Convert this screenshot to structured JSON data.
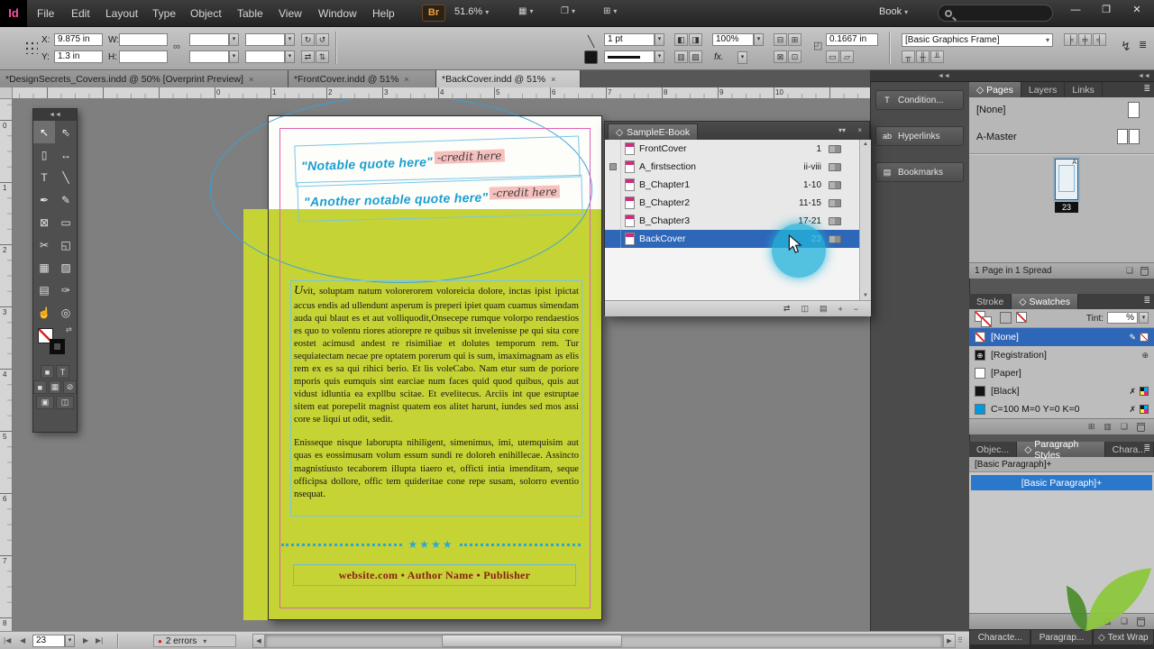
{
  "glyphs": {
    "dropdown": "▾",
    "collapse": "◄◄",
    "panel_menu": "≣",
    "tab_close": "×",
    "minimize_pair": "▾▾",
    "close": "×",
    "diamond": "◇",
    "chain": "∞",
    "rotate_cw": "↻",
    "rotate_ccw": "↺",
    "flip_h": "⇄",
    "flip_v": "⇅",
    "stroke_diag": "╲",
    "lightning": "↯",
    "prev": "◀",
    "next": "▶",
    "first": "|◀",
    "last": "▶|",
    "up": "▲",
    "down": "▼",
    "error_dot": "●",
    "reg_mark": "⊕",
    "pencil": "✎",
    "x_mark": "✗",
    "sync": "⇄",
    "save": "◫",
    "print": "▤",
    "plus": "+",
    "minus": "−",
    "new_page": "❏",
    "grip": "⠿",
    "win_min": "—",
    "win_restore": "❐",
    "win_close": "✕",
    "percent": "%",
    "fx": "fx.",
    "view_options": "▦",
    "screen_mode": "❐",
    "arrange_docs": "⊞",
    "corner": "◰",
    "m1": "◧",
    "m2": "◨",
    "m3": "▥",
    "m4": "▧",
    "m5": "▭",
    "m6": "▱",
    "b1": "⊟",
    "b2": "⊞",
    "b3": "⊠",
    "b4": "⊡",
    "a1": "╞",
    "a2": "╪",
    "a3": "╡",
    "a4": "╥",
    "a5": "╫",
    "a6": "╨"
  },
  "menubar": {
    "logo": "Id",
    "items": [
      "File",
      "Edit",
      "Layout",
      "Type",
      "Object",
      "Table",
      "View",
      "Window",
      "Help"
    ],
    "bridge": "Br",
    "zoom": "51.6%",
    "workspace": "Book"
  },
  "control_panel": {
    "x_label": "X:",
    "x_value": "9.875 in",
    "y_label": "Y:",
    "y_value": "1.3 in",
    "w_label": "W:",
    "w_value": "",
    "h_label": "H:",
    "h_value": "",
    "scale_x": "",
    "scale_y": "",
    "rotation": "",
    "shear": "",
    "stroke_weight": "1 pt",
    "opacity": "100%",
    "corner_radius": "0.1667 in",
    "style_name": "[Basic Graphics Frame]"
  },
  "doc_tabs": [
    {
      "label": "*DesignSecrets_Covers.indd @ 50% [Overprint Preview]"
    },
    {
      "label": "*FrontCover.indd @ 51%"
    },
    {
      "label": "*BackCover.indd @ 51%"
    }
  ],
  "rulers": {
    "h": [
      "0",
      "1",
      "2",
      "3",
      "4",
      "5",
      "6",
      "7",
      "8",
      "9",
      "10"
    ],
    "v": [
      "0",
      "1",
      "2",
      "3",
      "4",
      "5",
      "6",
      "7",
      "8"
    ]
  },
  "tools": [
    {
      "name": "selection-tool",
      "glyph": "↖"
    },
    {
      "name": "direct-selection-tool",
      "glyph": "⇖"
    },
    {
      "name": "page-tool",
      "glyph": "▯"
    },
    {
      "name": "gap-tool",
      "glyph": "↔"
    },
    {
      "name": "type-tool",
      "glyph": "T"
    },
    {
      "name": "line-tool",
      "glyph": "╲"
    },
    {
      "name": "pen-tool",
      "glyph": "✒"
    },
    {
      "name": "pencil-tool",
      "glyph": "✎"
    },
    {
      "name": "rectangle-frame-tool",
      "glyph": "⊠"
    },
    {
      "name": "rectangle-tool",
      "glyph": "▭"
    },
    {
      "name": "scissors-tool",
      "glyph": "✂"
    },
    {
      "name": "free-transform-tool",
      "glyph": "◱"
    },
    {
      "name": "gradient-swatch-tool",
      "glyph": "▦"
    },
    {
      "name": "gradient-feather-tool",
      "glyph": "▨"
    },
    {
      "name": "note-tool",
      "glyph": "▤"
    },
    {
      "name": "eyedropper-tool",
      "glyph": "✑"
    },
    {
      "name": "hand-tool",
      "glyph": "☝"
    },
    {
      "name": "zoom-tool",
      "glyph": "◎"
    }
  ],
  "tool_extras": {
    "container": "■",
    "text": "T",
    "fill": "■",
    "gradient": "▦",
    "none": "⊘",
    "normal": "▣",
    "preview": "◫"
  },
  "document": {
    "quote1": "\"Notable quote here\"",
    "credit1": "-credit here",
    "quote2": "\"Another notable quote here\"",
    "credit2": "-credit here",
    "body_p1": "Uvit, soluptam natum volorerorem voloreicia dolore, inctas ipist ipictat accus endis ad ullendunt asperum is preperi ipiet quam cuamus simendam auda qui blaut es et aut volliquodit,Onsecepe rumque volorpo rendaestios es quo to volentu riores atiorepre re quibus sit invelenisse pe qui sita core eostet acimusd andest re risimiliae et dolutes temporum rem. Tur sequiatectam necae pre optatem porerum qui is sum, imaximagnam as elis rem ex es sa qui rihici berio. Et lis voleCabo. Nam etur sum de poriore mporis quis eumquis sint earciae num faces quid quod quibus, quis aut vidust idluntia ea expllbu scitae. Et evelitecus. Arciis int que estruptae sitem eat porepelit magnist quatem eos alitet harunt, iundes sed mos assi core se liqui ut odit, sedit.",
    "body_p2": "Enisseque nisque laborupta nihiligent, simenimus, imi, utemquisim aut quas es eossimusam volum essum sundi re doloreh enihillecae. Assincto magnistiusto tecaborem illupta tiaero et, officti intia imenditam, seque officipsa dollore, offic tem quideritae cone repe susam, solorro eventio nsequat.",
    "stars": "★★★★",
    "footer": "website.com • Author Name • Publisher"
  },
  "book_panel": {
    "title": "SampleE-Book",
    "rows": [
      {
        "name": "FrontCover",
        "pages": "1"
      },
      {
        "name": "A_firstsection",
        "pages": "ii-viii"
      },
      {
        "name": "B_Chapter1",
        "pages": "1-10"
      },
      {
        "name": "B_Chapter2",
        "pages": "11-15"
      },
      {
        "name": "B_Chapter3",
        "pages": "17-21"
      },
      {
        "name": "BackCover",
        "pages": "23"
      }
    ]
  },
  "dock_buttons": [
    {
      "label": "Condition...",
      "glyph": "T"
    },
    {
      "label": "Hyperlinks",
      "glyph": "ab"
    },
    {
      "label": "Bookmarks",
      "glyph": "▤"
    }
  ],
  "pages_panel": {
    "tabs": [
      "Pages",
      "Layers",
      "Links"
    ],
    "none_label": "[None]",
    "master_label": "A-Master",
    "master_letter": "A",
    "page_badge": "23",
    "status": "1 Page in 1 Spread"
  },
  "swatches_panel": {
    "stroke_tab": "Stroke",
    "swatches_tab": "Swatches",
    "tint_label": "Tint:",
    "rows": [
      {
        "name": "[None]"
      },
      {
        "name": "[Registration]"
      },
      {
        "name": "[Paper]"
      },
      {
        "name": "[Black]"
      },
      {
        "name": "C=100 M=0 Y=0 K=0"
      }
    ]
  },
  "styles_panel": {
    "tab_object": "Objec...",
    "tab_paragraph": "Paragraph Styles",
    "tab_character": "Chara...",
    "current_style": "[Basic Paragraph]+",
    "selected_style": "[Basic Paragraph]+"
  },
  "bottom_tabs": [
    "Characte...",
    "Paragrap...",
    "Text Wrap"
  ],
  "status_bar": {
    "page": "23",
    "errors": "2 errors"
  },
  "colors": {
    "cover_green": "#c5d335",
    "quote_cyan": "#1b9ed2",
    "footer_red": "#8d1b1b",
    "selection_blue": "#2e66b8",
    "halo_cyan": "#24b4da",
    "swatch_cyan": "#0099dd",
    "margin_pink": "#df5fb9"
  }
}
